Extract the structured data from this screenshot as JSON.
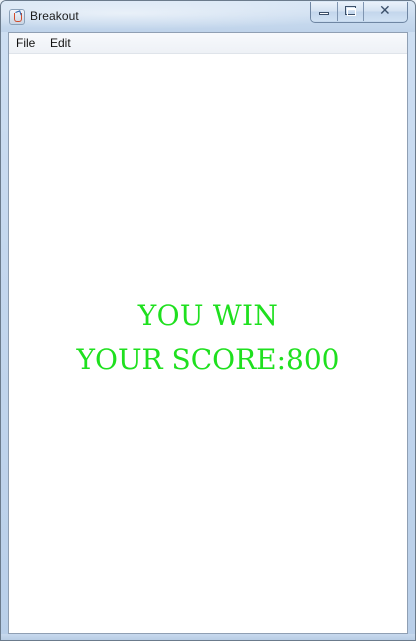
{
  "window": {
    "title": "Breakout",
    "icon": "java-coffee-icon",
    "controls": {
      "minimize_icon": "minimize-icon",
      "maximize_icon": "maximize-icon",
      "close_icon": "close-icon",
      "close_glyph": "✕"
    }
  },
  "menubar": {
    "items": [
      {
        "label": "File"
      },
      {
        "label": "Edit"
      }
    ]
  },
  "game": {
    "message": "YOU WIN",
    "score_text": "YOUR SCORE:800",
    "text_color": "#1fe01f",
    "background": "#ffffff"
  }
}
